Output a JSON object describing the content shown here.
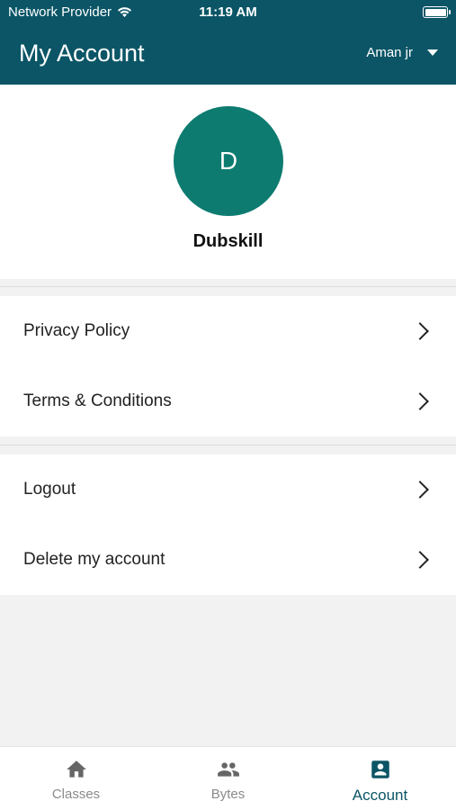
{
  "status_bar": {
    "carrier": "Network Provider",
    "time": "11:19 AM"
  },
  "header": {
    "title": "My Account",
    "user_name": "Aman jr"
  },
  "profile": {
    "initial": "D",
    "name": "Dubskill"
  },
  "menu": {
    "group1": [
      "Privacy Policy",
      "Terms & Conditions"
    ],
    "group2": [
      "Logout",
      "Delete my account"
    ]
  },
  "tabs": [
    {
      "label": "Classes",
      "icon": "home-icon"
    },
    {
      "label": "Bytes",
      "icon": "people-icon"
    },
    {
      "label": "Account",
      "icon": "account-box-icon",
      "active": true
    }
  ],
  "colors": {
    "header_bg": "#0b5566",
    "avatar_bg": "#0d7b70",
    "active_tab": "#0b5566"
  }
}
